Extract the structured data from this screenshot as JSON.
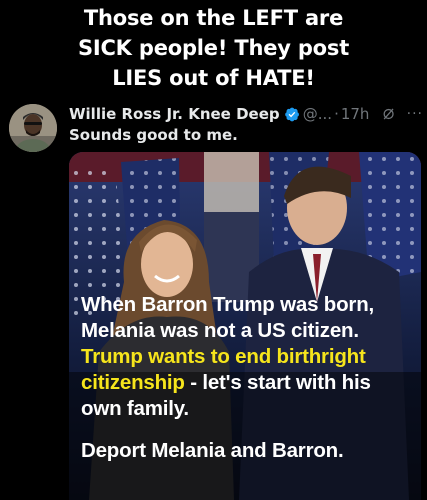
{
  "caption": {
    "line1": "Those on the LEFT are",
    "line2": "SICK people! They post",
    "line3": "LIES out of HATE!"
  },
  "tweet": {
    "author_name": "Willie Ross Jr. Knee Deep",
    "handle": "@...",
    "separator": "·",
    "time": "17h",
    "more": "···",
    "text": "Sounds good to me."
  },
  "image_text": {
    "line1": "When Barron Trump was born,",
    "line2": "Melania was not a US citizen.",
    "line3": "Trump wants to end birthright",
    "line4_yellow": "citizenship",
    "line4_rest": " - let's start with his",
    "line5": "own family.",
    "line6": "Deport Melania and Barron."
  },
  "colors": {
    "verified": "#1d9bf0",
    "highlight": "#f6e51c",
    "muted": "#71767b"
  }
}
